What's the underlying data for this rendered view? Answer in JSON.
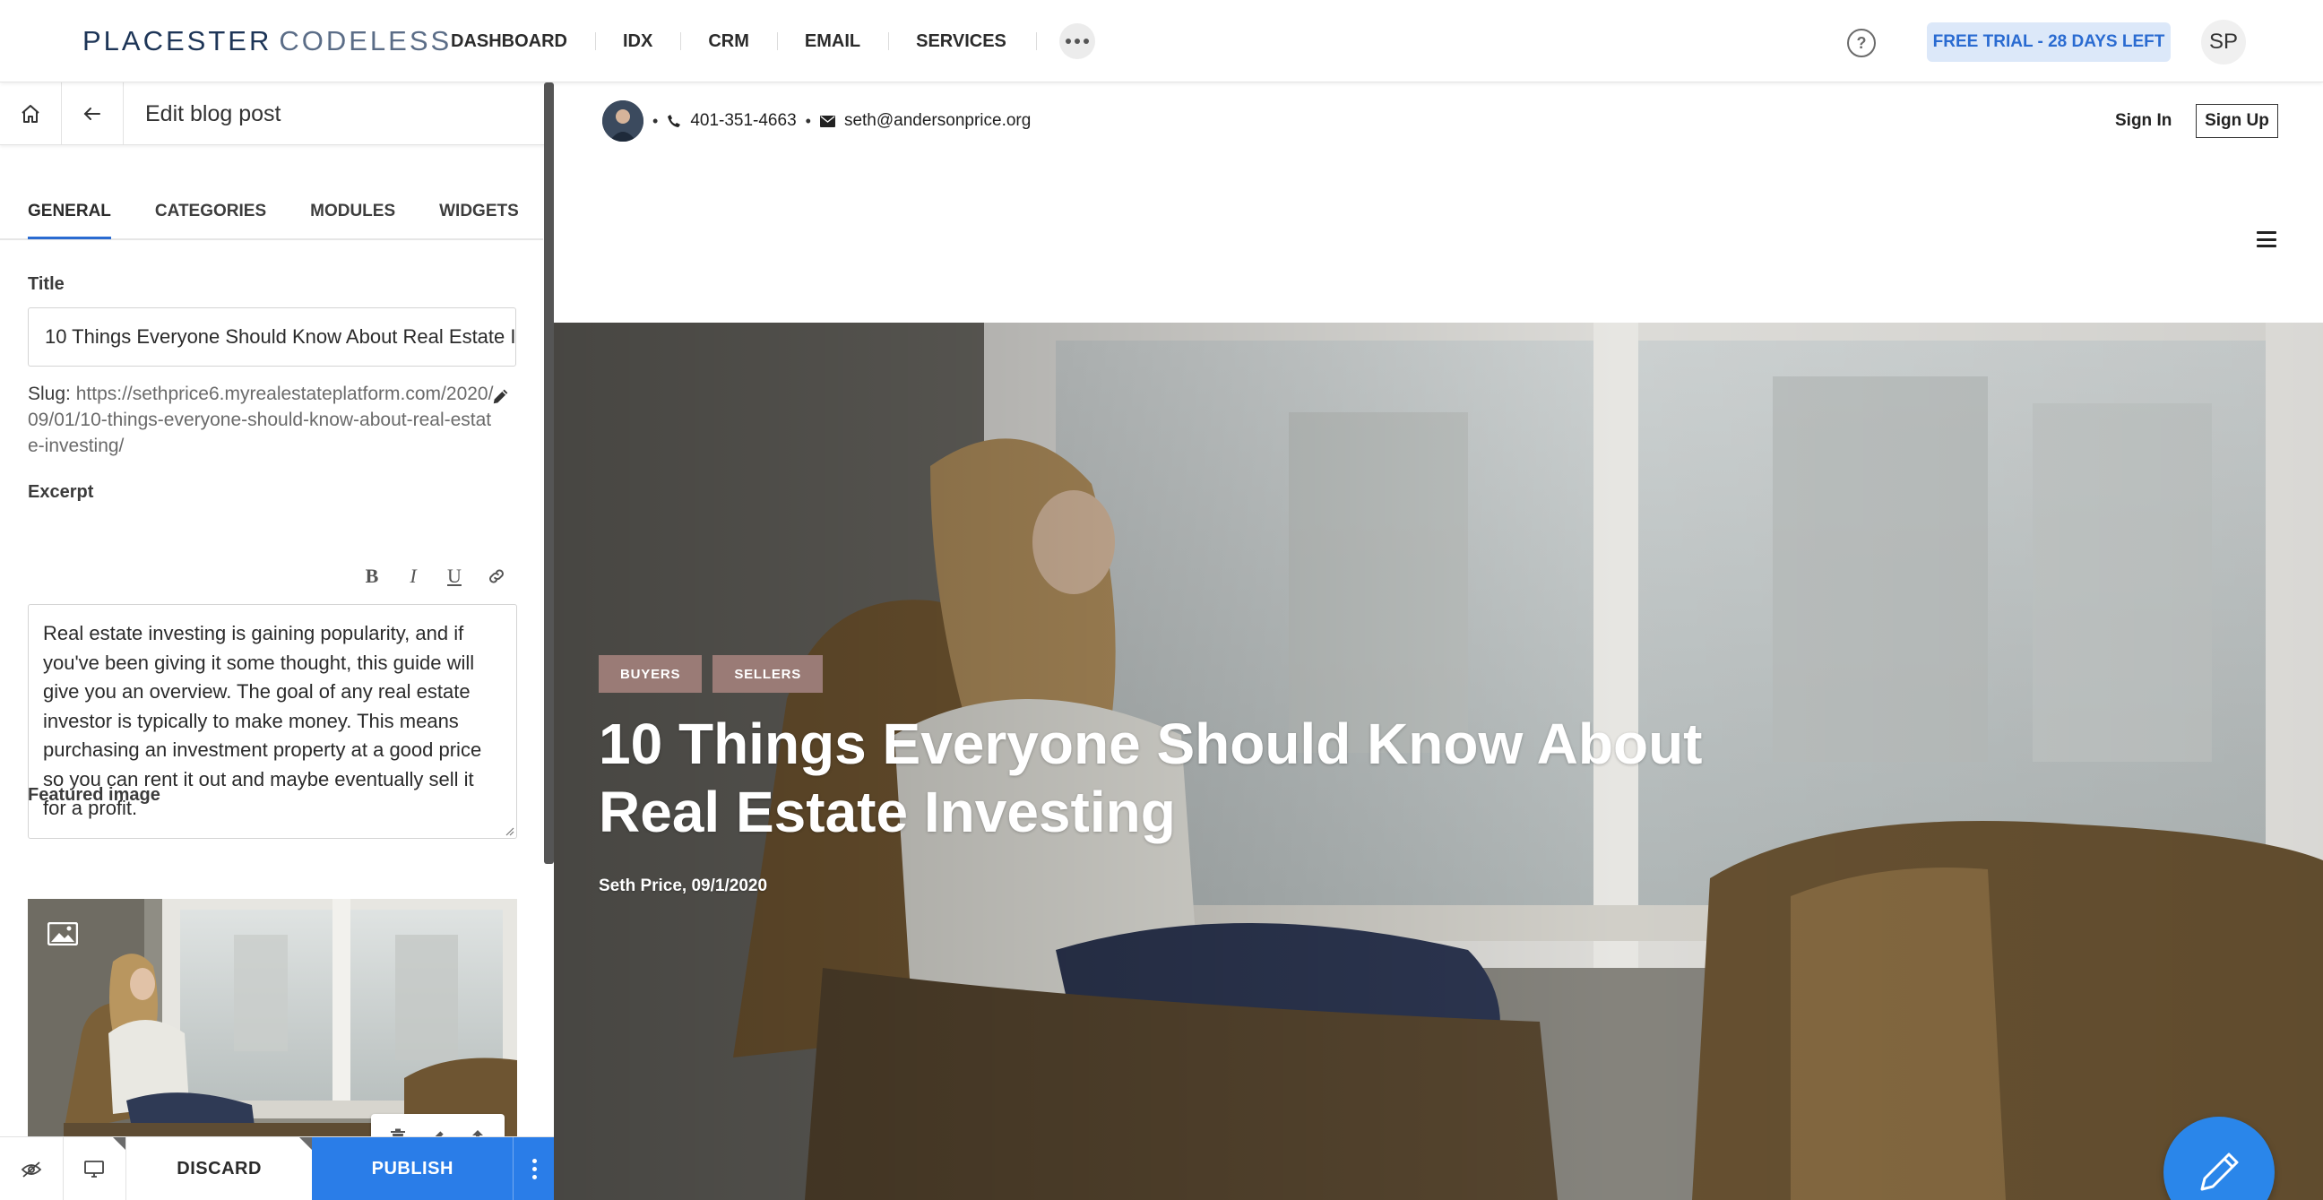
{
  "app": {
    "logo_part1": "PLACESTER",
    "logo_part2": "CODELESS"
  },
  "nav": {
    "items": [
      {
        "label": "DASHBOARD"
      },
      {
        "label": "IDX"
      },
      {
        "label": "CRM"
      },
      {
        "label": "EMAIL"
      },
      {
        "label": "SERVICES"
      }
    ],
    "help_icon": "question-circle",
    "trial_label": "FREE TRIAL - 28 DAYS LEFT",
    "user_initials": "SP"
  },
  "editor": {
    "header_title": "Edit blog post",
    "tabs": [
      {
        "label": "GENERAL",
        "active": true
      },
      {
        "label": "CATEGORIES",
        "active": false
      },
      {
        "label": "MODULES",
        "active": false
      },
      {
        "label": "WIDGETS",
        "active": false
      }
    ],
    "title_label": "Title",
    "title_value": "10 Things Everyone Should Know About Real Estate Investing",
    "slug_label": "Slug:",
    "slug_value": "https://sethprice6.myrealestateplatform.com/2020/09/01/10-things-everyone-should-know-about-real-estate-investing/",
    "excerpt_label": "Excerpt",
    "excerpt_value": "Real estate investing is gaining popularity, and if you've been giving it some thought, this guide will give you an overview. The goal of any real estate investor is typically to make money. This means purchasing an investment property at a good price so you can rent it out and maybe eventually sell it for a profit.",
    "featured_label": "Featured image"
  },
  "actions": {
    "discard_label": "DISCARD",
    "publish_label": "PUBLISH"
  },
  "preview": {
    "phone": "401-351-4663",
    "email": "seth@andersonprice.org",
    "sign_in": "Sign In",
    "sign_up": "Sign Up",
    "tags": [
      "BUYERS",
      "SELLERS"
    ],
    "post_title": "10 Things Everyone Should Know About Real Estate Investing",
    "byline": "Seth Price, 09/1/2020"
  },
  "colors": {
    "accent": "#2a7de8",
    "trial_bg": "#dce8f9",
    "tag_bg": "#9a7b76",
    "fab": "#2a86ea"
  }
}
